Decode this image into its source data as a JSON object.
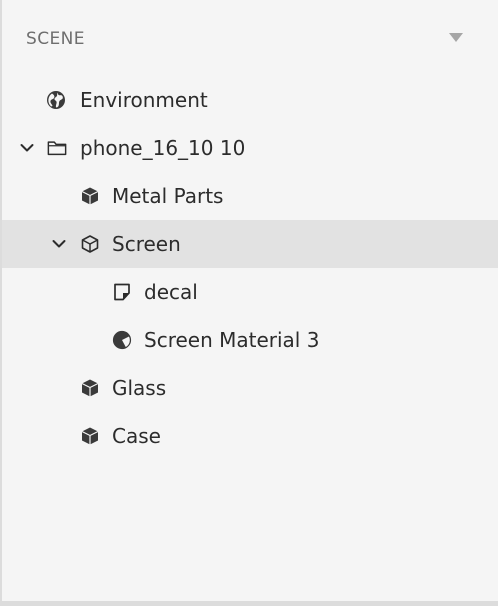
{
  "header": {
    "title": "SCENE",
    "menu_icon": "triangle-down-icon"
  },
  "tree": {
    "items": [
      {
        "label": "Environment",
        "icon": "globe-icon",
        "depth": 0,
        "expanded": null,
        "selected": false
      },
      {
        "label": "phone_16_10 10",
        "icon": "folder-icon",
        "depth": 0,
        "expanded": true,
        "selected": false
      },
      {
        "label": "Metal Parts",
        "icon": "cube-icon",
        "depth": 1,
        "expanded": null,
        "selected": false
      },
      {
        "label": "Screen",
        "icon": "cube-outline-icon",
        "depth": 1,
        "expanded": true,
        "selected": true
      },
      {
        "label": "decal",
        "icon": "decal-icon",
        "depth": 2,
        "expanded": null,
        "selected": false
      },
      {
        "label": "Screen Material 3",
        "icon": "material-icon",
        "depth": 2,
        "expanded": null,
        "selected": false
      },
      {
        "label": "Glass",
        "icon": "cube-icon",
        "depth": 1,
        "expanded": null,
        "selected": false
      },
      {
        "label": "Case",
        "icon": "cube-icon",
        "depth": 1,
        "expanded": null,
        "selected": false
      }
    ]
  },
  "colors": {
    "panel_bg": "#f5f5f5",
    "selected_bg": "#e2e2e2",
    "text": "#2c2c2c",
    "header_text": "#6e6e6e"
  }
}
